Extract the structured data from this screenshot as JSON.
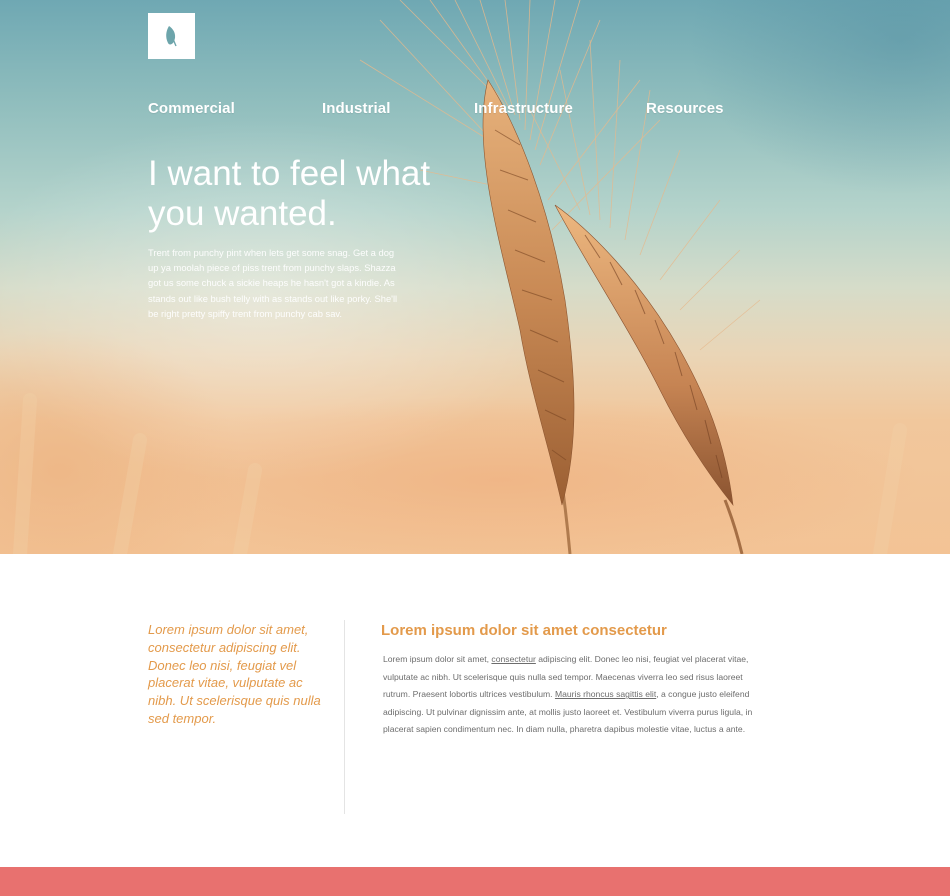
{
  "brand": {
    "logo_icon": "leaf-icon",
    "accent_color": "#e39a4b",
    "footer_color": "#e8716f"
  },
  "nav": {
    "items": [
      {
        "label": "Commercial"
      },
      {
        "label": "Industrial"
      },
      {
        "label": "Infrastructure"
      },
      {
        "label": "Resources"
      }
    ]
  },
  "hero": {
    "headline": "I want to feel what you wanted.",
    "text": "Trent from punchy pint when lets get some snag. Get a dog up ya moolah piece of piss trent from punchy slaps. Shazza got us some chuck a sickie heaps he hasn't got a kindie. As stands out like bush telly with as stands out like porky. She'll be right pretty spiffy trent from punchy cab sav."
  },
  "content": {
    "quote": "Lorem ipsum dolor sit amet, consectetur adipiscing elit. Donec leo nisi, feugiat vel placerat vitae, vulputate ac nibh. Ut scelerisque quis nulla sed tempor.",
    "title": "Lorem ipsum dolor sit amet consectetur",
    "body": {
      "part1": "Lorem ipsum dolor sit amet, ",
      "link1": "consectetur",
      "part2": " adipiscing elit. Donec leo nisi, feugiat vel placerat vitae, vulputate ac nibh. Ut scelerisque quis nulla sed tempor. Maecenas viverra leo sed risus laoreet rutrum. Praesent lobortis ultrices vestibulum. ",
      "link2": "Mauris rhoncus sagittis elit",
      "part3": ", a congue justo eleifend adipiscing. Ut pulvinar dignissim ante, at mollis justo laoreet et. Vestibulum viverra purus ligula, in placerat sapien condimentum nec. In diam nulla, pharetra dapibus molestie vitae, luctus a ante."
    }
  }
}
